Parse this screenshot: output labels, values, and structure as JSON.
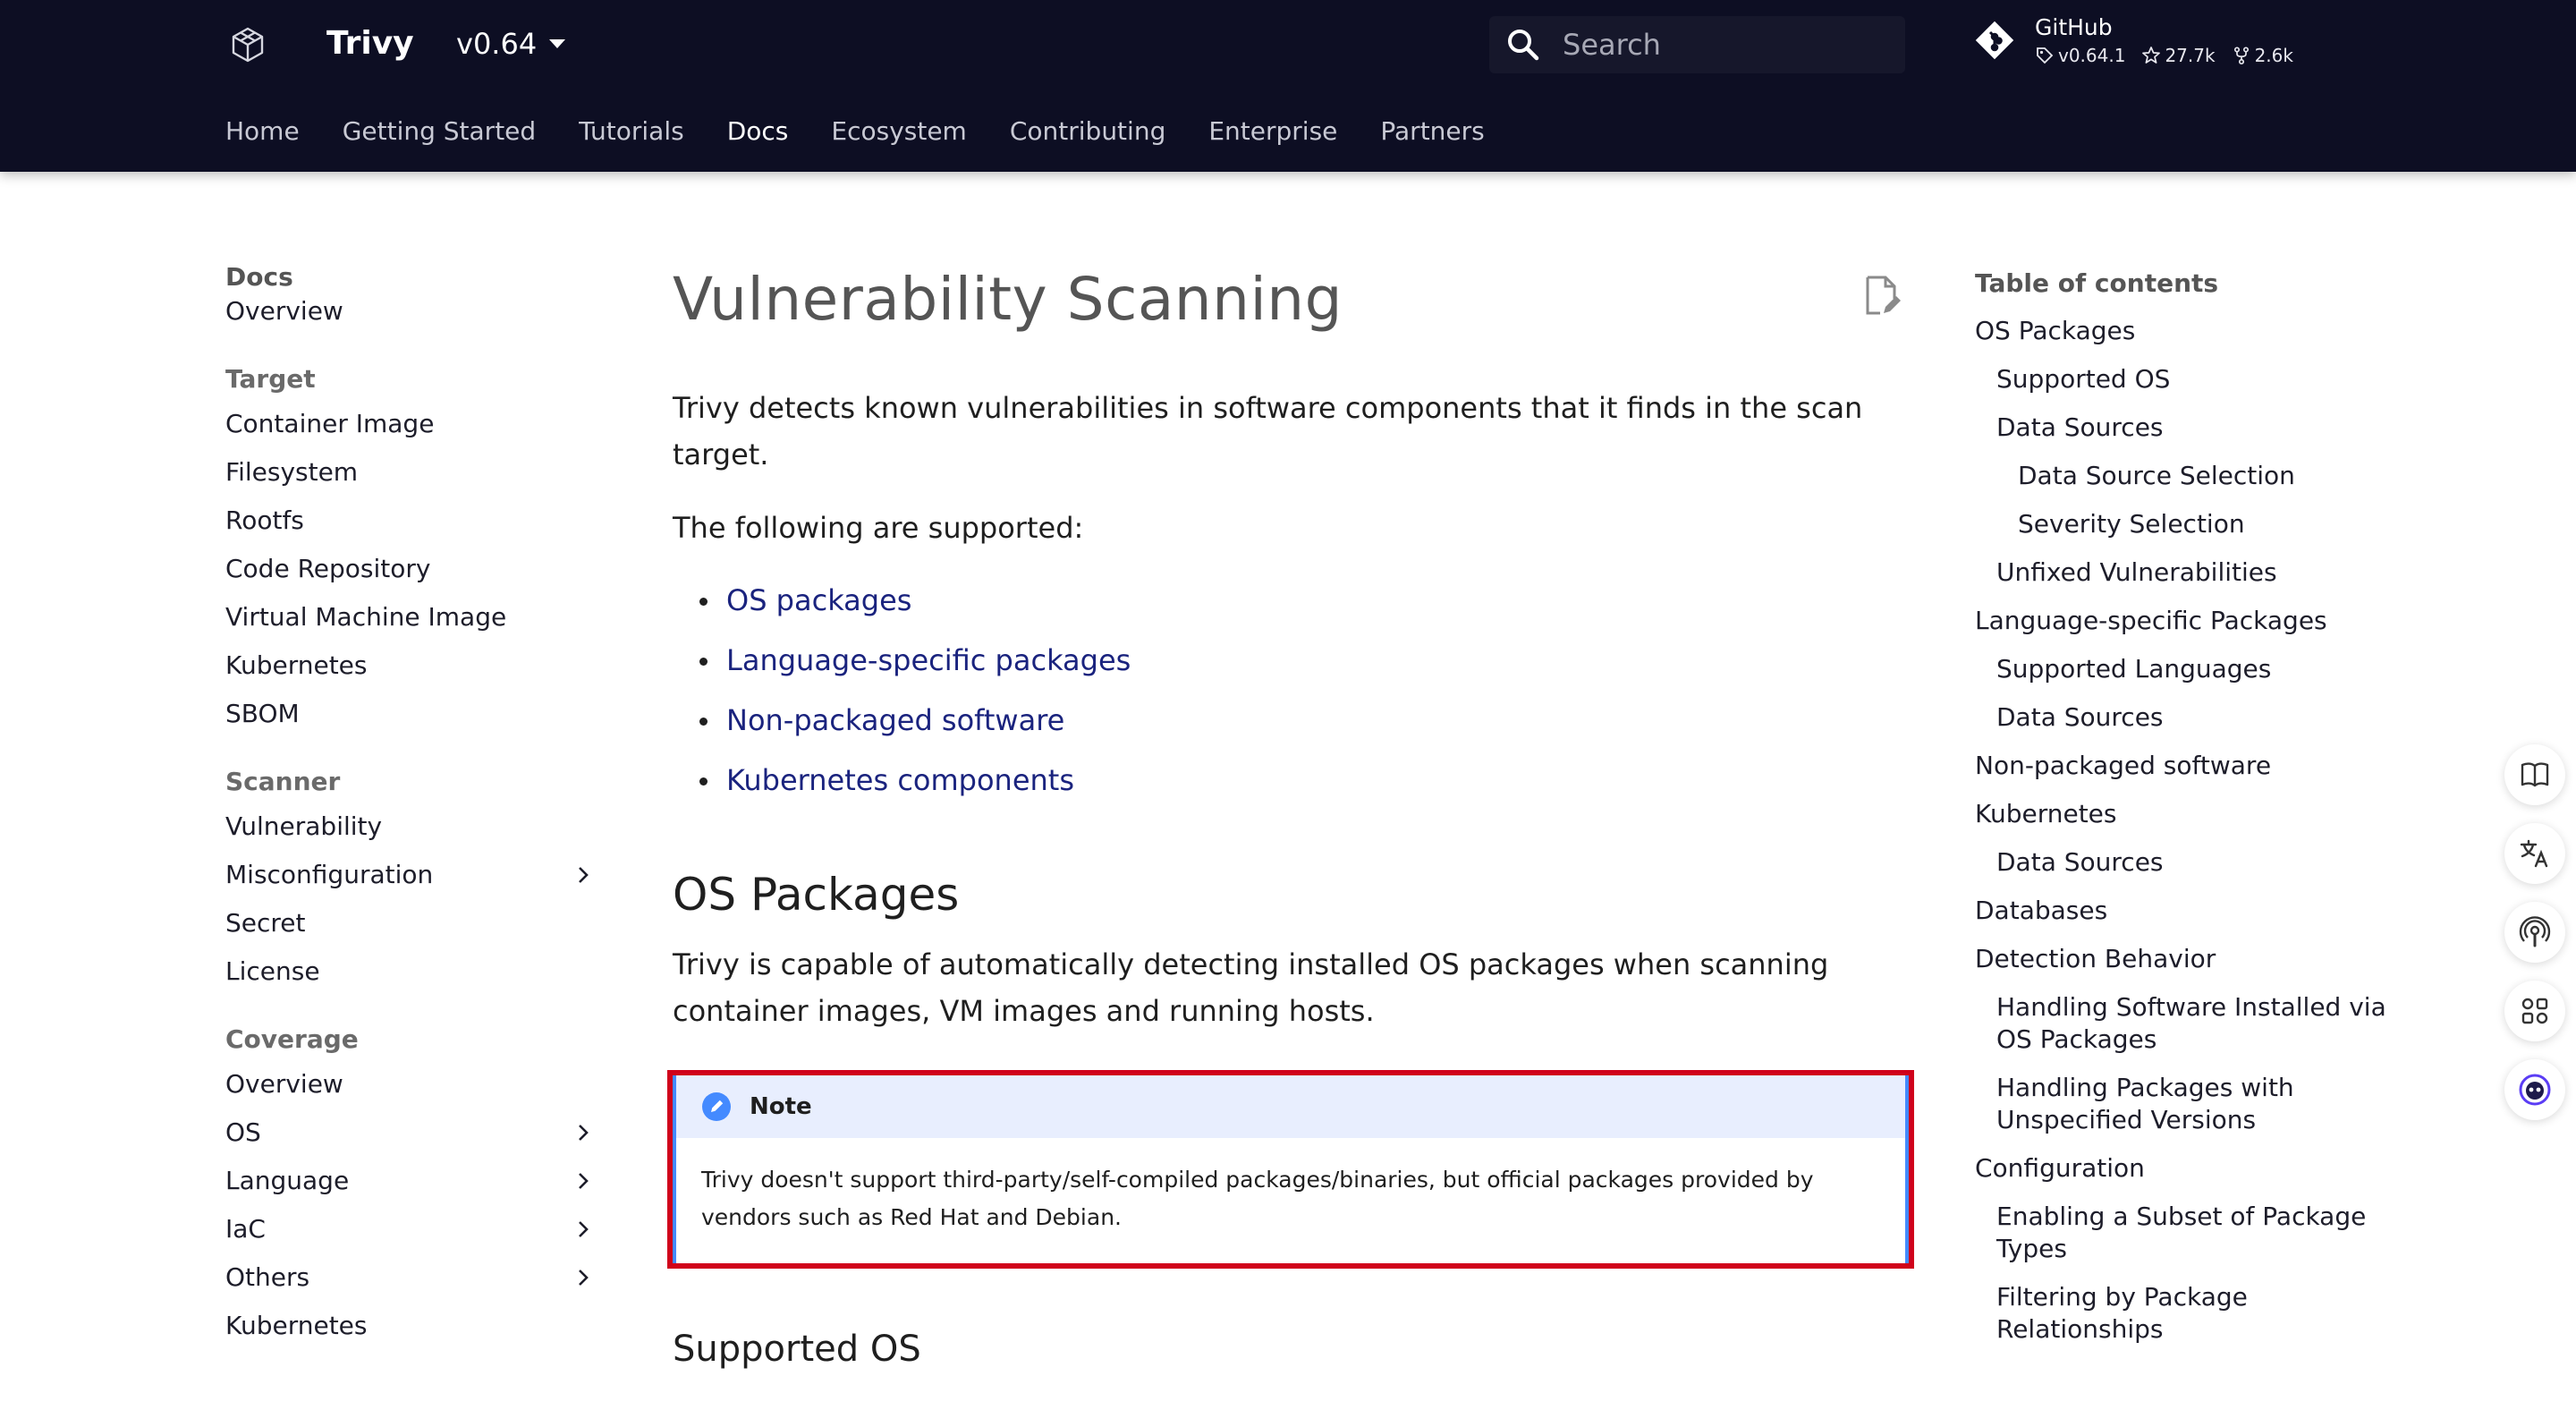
{
  "header": {
    "site_title": "Trivy",
    "version": "v0.64",
    "search_placeholder": "Search",
    "repo": {
      "name": "GitHub",
      "tag": "v0.64.1",
      "stars": "27.7k",
      "forks": "2.6k"
    },
    "tabs": [
      {
        "label": "Home"
      },
      {
        "label": "Getting Started"
      },
      {
        "label": "Tutorials"
      },
      {
        "label": "Docs"
      },
      {
        "label": "Ecosystem"
      },
      {
        "label": "Contributing"
      },
      {
        "label": "Enterprise"
      },
      {
        "label": "Partners"
      }
    ],
    "active_tab": "Docs"
  },
  "sidebar": {
    "title": "Docs",
    "overview": "Overview",
    "target": {
      "title": "Target",
      "items": [
        "Container Image",
        "Filesystem",
        "Rootfs",
        "Code Repository",
        "Virtual Machine Image",
        "Kubernetes",
        "SBOM"
      ]
    },
    "scanner": {
      "title": "Scanner",
      "items": [
        "Vulnerability",
        "Misconfiguration",
        "Secret",
        "License"
      ]
    },
    "coverage": {
      "title": "Coverage",
      "items": [
        "Overview",
        "OS",
        "Language",
        "IaC",
        "Others",
        "Kubernetes"
      ]
    }
  },
  "main": {
    "title": "Vulnerability Scanning",
    "intro": "Trivy detects known vulnerabilities in software components that it finds in the scan target.",
    "supported_intro": "The following are supported:",
    "links": [
      "OS packages",
      "Language-specific packages",
      "Non-packaged software",
      "Kubernetes components"
    ],
    "os_heading": "OS Packages",
    "os_text": "Trivy is capable of automatically detecting installed OS packages when scanning container images, VM images and running hosts.",
    "note": {
      "title": "Note",
      "body": "Trivy doesn't support third-party/self-compiled packages/binaries, but official packages provided by vendors such as Red Hat and Debian."
    },
    "supported_os_heading": "Supported OS"
  },
  "toc": {
    "title": "Table of contents",
    "items": [
      {
        "label": "OS Packages",
        "level": 1
      },
      {
        "label": "Supported OS",
        "level": 2
      },
      {
        "label": "Data Sources",
        "level": 2
      },
      {
        "label": "Data Source Selection",
        "level": 3
      },
      {
        "label": "Severity Selection",
        "level": 3
      },
      {
        "label": "Unfixed Vulnerabilities",
        "level": 2
      },
      {
        "label": "Language-specific Packages",
        "level": 1
      },
      {
        "label": "Supported Languages",
        "level": 2
      },
      {
        "label": "Data Sources",
        "level": 2
      },
      {
        "label": "Non-packaged software",
        "level": 1
      },
      {
        "label": "Kubernetes",
        "level": 1
      },
      {
        "label": "Data Sources",
        "level": 2
      },
      {
        "label": "Databases",
        "level": 1
      },
      {
        "label": "Detection Behavior",
        "level": 1
      },
      {
        "label": "Handling Software Installed via OS Packages",
        "level": 2
      },
      {
        "label": "Handling Packages with Unspecified Versions",
        "level": 2
      },
      {
        "label": "Configuration",
        "level": 1
      },
      {
        "label": "Enabling a Subset of Package Types",
        "level": 2
      },
      {
        "label": "Filtering by Package Relationships",
        "level": 2
      }
    ]
  },
  "colors": {
    "header_bg": "#0d0e23",
    "link": "#1a237e",
    "note_accent": "#448aff",
    "highlight_border": "#d0021b"
  },
  "floating_tools": [
    "book-icon",
    "translate-icon",
    "podcast-icon",
    "grid-icon",
    "assistant-icon"
  ]
}
